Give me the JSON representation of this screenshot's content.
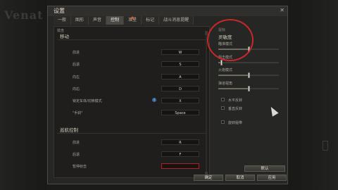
{
  "background": {
    "logo_text": "Venat"
  },
  "dialog": {
    "title": "设置",
    "close": "✕",
    "tabs": [
      {
        "label": "一般"
      },
      {
        "label": "图形"
      },
      {
        "label": "声音"
      },
      {
        "label": "控制",
        "active": true
      },
      {
        "label": "准星"
      },
      {
        "label": "标记"
      },
      {
        "label": "战斗消息提醒"
      }
    ]
  },
  "left": {
    "panel_label": "键盘",
    "section1": "移动",
    "move_rows": [
      {
        "label": "前进",
        "key": "W"
      },
      {
        "label": "后退",
        "key": "S"
      },
      {
        "label": "向左",
        "key": "A"
      },
      {
        "label": "向右",
        "key": "D"
      },
      {
        "label": "锁定车体/切换模式",
        "key": "X"
      },
      {
        "label": "\"手刹\"",
        "key": "Space"
      }
    ],
    "section2": "巡航控制",
    "cruise_rows": [
      {
        "label": "前进",
        "key": "R"
      },
      {
        "label": "后退",
        "key": "F"
      },
      {
        "label": "暂停射击",
        "key": ""
      }
    ]
  },
  "right": {
    "panel_label": "鼠标",
    "heading": "灵敏度",
    "sliders": [
      {
        "label": "瞄准模式",
        "value": 0.5
      },
      {
        "label": "狙击模式",
        "value": 0.05
      },
      {
        "label": "火炮模式",
        "value": 0.5
      },
      {
        "label": "弹道视角",
        "value": 0.5
      }
    ],
    "checkboxes": [
      {
        "label": "水平反转"
      },
      {
        "label": "垂直反转"
      },
      {
        "label": "旋转履带"
      }
    ]
  },
  "buttons": {
    "default": "默认",
    "ok": "确定",
    "cancel": "取消",
    "apply": "应用"
  },
  "colors": {
    "accent": "#d8602a",
    "highlight_circle": "#c8282a",
    "key_error_border": "#b02020"
  }
}
